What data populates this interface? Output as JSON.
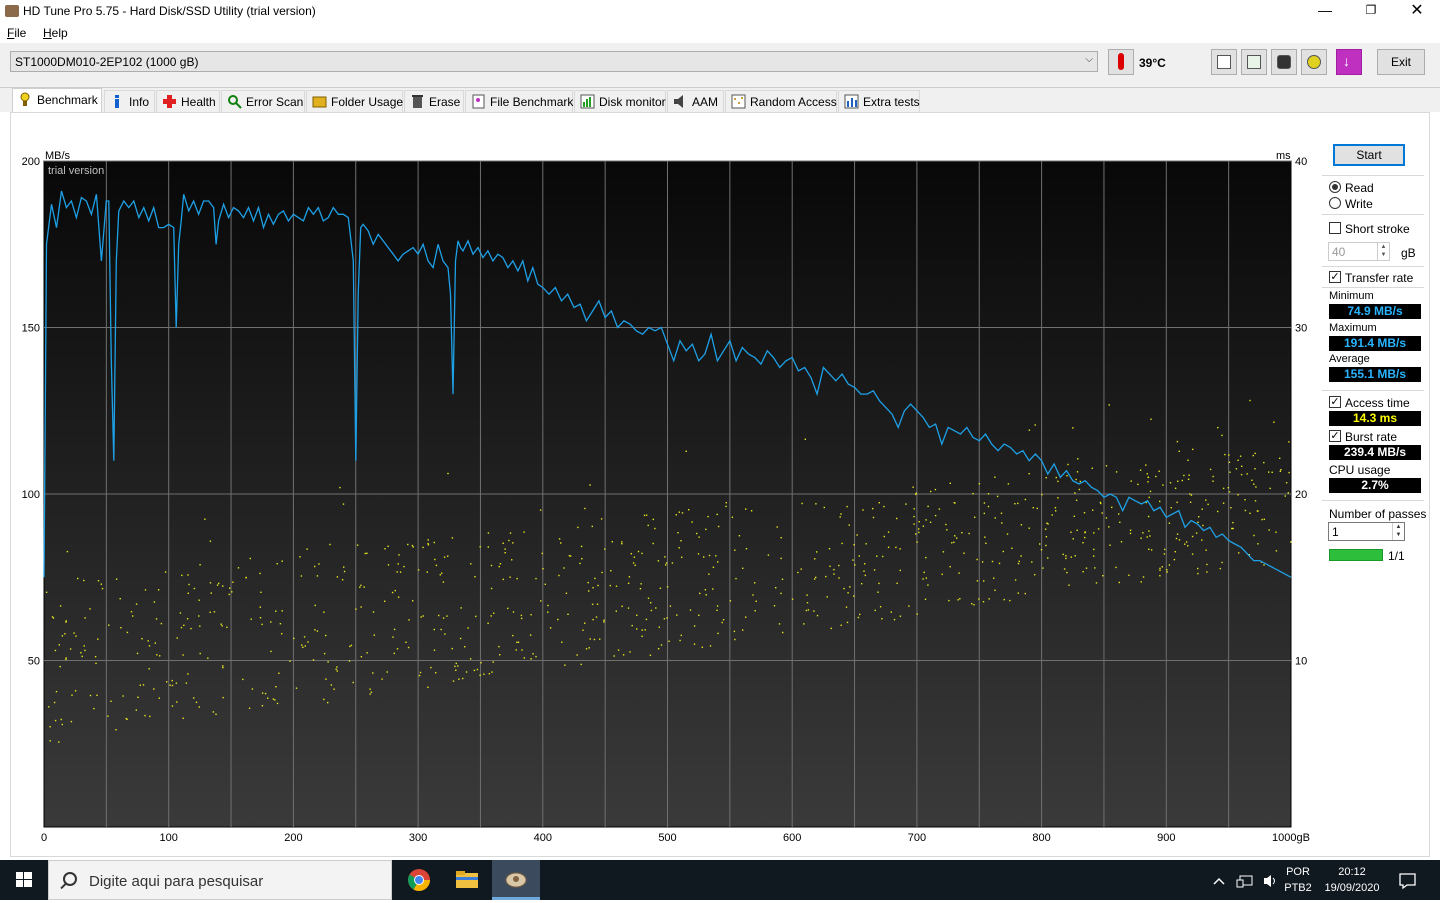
{
  "window": {
    "title": "HD Tune Pro 5.75 - Hard Disk/SSD Utility (trial version)",
    "controls": {
      "minimize": "—",
      "maximize": "❐",
      "close": "✕"
    }
  },
  "menu": {
    "file": "File",
    "file_hotkey": "F",
    "file_rest": "ile",
    "help": "Help",
    "help_hotkey": "H",
    "help_rest": "elp"
  },
  "toolbar": {
    "drive": "ST1000DM010-2EP102 (1000 gB)",
    "temperature": "39°C",
    "exit_label": "Exit",
    "icons": [
      "copy-text-icon",
      "copy-info-icon",
      "screenshot-icon",
      "options-icon",
      "save-icon"
    ]
  },
  "tabs": [
    {
      "label": "Benchmark",
      "icon": "benchmark-icon",
      "active": true
    },
    {
      "label": "Info",
      "icon": "info-icon"
    },
    {
      "label": "Health",
      "icon": "health-icon"
    },
    {
      "label": "Error Scan",
      "icon": "error-scan-icon"
    },
    {
      "label": "Folder Usage",
      "icon": "folder-usage-icon"
    },
    {
      "label": "Erase",
      "icon": "erase-icon"
    },
    {
      "label": "File Benchmark",
      "icon": "file-benchmark-icon"
    },
    {
      "label": "Disk monitor",
      "icon": "disk-monitor-icon"
    },
    {
      "label": "AAM",
      "icon": "aam-icon"
    },
    {
      "label": "Random Access",
      "icon": "random-access-icon"
    },
    {
      "label": "Extra tests",
      "icon": "extra-tests-icon"
    }
  ],
  "panel": {
    "start_label": "Start",
    "read_label": "Read",
    "write_label": "Write",
    "mode": "Read",
    "short_stroke_label": "Short stroke",
    "short_stroke_checked": false,
    "short_stroke_value": "40",
    "short_stroke_unit": "gB",
    "transfer_rate_label": "Transfer rate",
    "transfer_rate_checked": true,
    "minimum_label": "Minimum",
    "minimum_value": "74.9 MB/s",
    "maximum_label": "Maximum",
    "maximum_value": "191.4 MB/s",
    "average_label": "Average",
    "average_value": "155.1 MB/s",
    "access_time_label": "Access time",
    "access_time_checked": true,
    "access_time_value": "14.3 ms",
    "burst_rate_label": "Burst rate",
    "burst_rate_checked": true,
    "burst_rate_value": "239.4 MB/s",
    "cpu_usage_label": "CPU usage",
    "cpu_usage_value": "2.7%",
    "passes_label": "Number of passes",
    "passes_value": "1",
    "progress_value": 1.0,
    "progress_text": "1/1"
  },
  "taskbar": {
    "search_placeholder": "Digite aqui para pesquisar",
    "lang_top": "POR",
    "lang_bottom": "PTB2",
    "time": "20:12",
    "date": "19/09/2020",
    "apps": [
      "chrome-icon",
      "file-explorer-icon",
      "hdtune-icon"
    ]
  },
  "chart_data": {
    "type": "line",
    "watermark": "trial version",
    "ylabel_left": "MB/s",
    "ylabel_right": "ms",
    "xunit": "gB",
    "xlim": [
      0,
      1000
    ],
    "ylim_left": [
      0,
      200
    ],
    "ylim_right": [
      0,
      40
    ],
    "x_ticks": [
      0,
      100,
      200,
      300,
      400,
      500,
      600,
      700,
      800,
      900,
      1000
    ],
    "x_tick_labels": [
      "0",
      "100",
      "200",
      "300",
      "400",
      "500",
      "600",
      "700",
      "800",
      "900",
      "1000gB"
    ],
    "y_ticks_left": [
      50,
      100,
      150,
      200
    ],
    "y_ticks_right": [
      10,
      20,
      30,
      40
    ],
    "grid": true,
    "colors": {
      "transfer": "#1ea0e6",
      "access": "#e6e61e",
      "bg_top": "#0a0a0a",
      "bg_bottom": "#3a3a3a",
      "grid": "#707070"
    },
    "series": [
      {
        "kind": "transfer_rate_mbps",
        "x": [
          0,
          2,
          6,
          10,
          14,
          18,
          22,
          26,
          30,
          34,
          38,
          42,
          46,
          50,
          52,
          54,
          56,
          58,
          60,
          64,
          68,
          72,
          76,
          80,
          84,
          88,
          92,
          96,
          100,
          104,
          106,
          108,
          110,
          112,
          116,
          120,
          124,
          128,
          132,
          136,
          138,
          140,
          144,
          148,
          152,
          156,
          160,
          164,
          168,
          172,
          176,
          180,
          184,
          188,
          192,
          196,
          200,
          204,
          208,
          212,
          216,
          220,
          224,
          228,
          232,
          236,
          240,
          244,
          248,
          250,
          252,
          254,
          256,
          260,
          264,
          268,
          272,
          276,
          280,
          284,
          288,
          292,
          296,
          300,
          304,
          308,
          312,
          316,
          320,
          324,
          326,
          328,
          330,
          332,
          334,
          336,
          340,
          344,
          348,
          352,
          356,
          360,
          364,
          368,
          372,
          376,
          380,
          384,
          388,
          392,
          396,
          400,
          405,
          410,
          415,
          420,
          425,
          430,
          435,
          440,
          445,
          450,
          455,
          460,
          465,
          470,
          475,
          480,
          485,
          490,
          495,
          500,
          505,
          510,
          515,
          520,
          525,
          530,
          535,
          540,
          545,
          550,
          555,
          560,
          565,
          570,
          575,
          580,
          585,
          590,
          595,
          600,
          605,
          610,
          615,
          620,
          625,
          630,
          635,
          640,
          645,
          650,
          655,
          660,
          665,
          670,
          675,
          680,
          685,
          690,
          695,
          700,
          705,
          710,
          715,
          720,
          725,
          730,
          735,
          740,
          745,
          750,
          755,
          760,
          765,
          770,
          775,
          780,
          785,
          790,
          795,
          800,
          805,
          810,
          815,
          820,
          825,
          830,
          835,
          840,
          845,
          850,
          855,
          860,
          865,
          870,
          875,
          880,
          885,
          890,
          895,
          900,
          905,
          910,
          915,
          920,
          925,
          930,
          935,
          940,
          945,
          950,
          955,
          960,
          965,
          970,
          975,
          980,
          985,
          990,
          995,
          1000
        ],
        "y": [
          75,
          175,
          187,
          180,
          191,
          186,
          188,
          183,
          189,
          188,
          184,
          190,
          170,
          188,
          188,
          140,
          110,
          170,
          185,
          188,
          186,
          188,
          183,
          186,
          182,
          186,
          180,
          180,
          181,
          180,
          150,
          175,
          182,
          190,
          185,
          188,
          184,
          188,
          188,
          186,
          175,
          182,
          187,
          183,
          186,
          185,
          183,
          186,
          182,
          186,
          180,
          184,
          181,
          184,
          185,
          182,
          184,
          183,
          182,
          186,
          184,
          186,
          182,
          183,
          186,
          184,
          184,
          183,
          170,
          110,
          160,
          180,
          181,
          179,
          175,
          178,
          176,
          174,
          172,
          170,
          172,
          173,
          174,
          172,
          175,
          170,
          168,
          175,
          170,
          168,
          160,
          130,
          170,
          176,
          174,
          173,
          176,
          172,
          174,
          171,
          173,
          170,
          172,
          171,
          168,
          170,
          167,
          170,
          164,
          168,
          163,
          162,
          160,
          162,
          158,
          160,
          156,
          157,
          152,
          155,
          158,
          153,
          155,
          150,
          152,
          151,
          149,
          148,
          150,
          149,
          150,
          145,
          140,
          146,
          143,
          145,
          140,
          142,
          148,
          140,
          143,
          146,
          140,
          144,
          142,
          141,
          139,
          143,
          141,
          138,
          140,
          141,
          137,
          138,
          135,
          130,
          138,
          136,
          134,
          136,
          133,
          132,
          130,
          130,
          131,
          128,
          126,
          124,
          120,
          125,
          127,
          125,
          123,
          120,
          121,
          115,
          120,
          119,
          118,
          120,
          117,
          116,
          118,
          115,
          113,
          115,
          114,
          112,
          113,
          110,
          112,
          110,
          106,
          109,
          105,
          107,
          104,
          103,
          104,
          102,
          101,
          99,
          100,
          99,
          95,
          99,
          98,
          97,
          98,
          95,
          96,
          93,
          94,
          95,
          90,
          92,
          91,
          89,
          90,
          87,
          88,
          86,
          85,
          84,
          82,
          80,
          80,
          79,
          78,
          77,
          76,
          75
        ]
      },
      {
        "kind": "access_time_ms_scatter",
        "note_density": "access time points ranging roughly 5–22 ms, rising with position",
        "y_min_start": 5,
        "y_max_start": 15,
        "y_min_end": 16,
        "y_max_end": 23
      }
    ]
  }
}
